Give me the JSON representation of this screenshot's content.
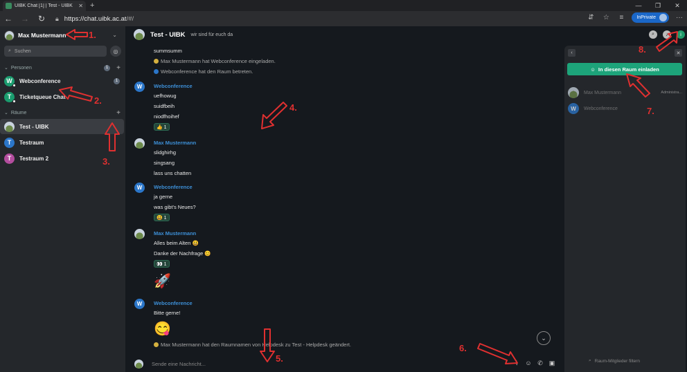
{
  "browser": {
    "tab_title": "UIBK Chat [1] | Test - UIBK",
    "tab_close": "✕",
    "new_tab": "+",
    "url_host": "https://chat.uibk.ac.at",
    "url_path": "/#/",
    "inprivate_label": "InPrivate",
    "win_minimize": "—",
    "win_restore": "❐",
    "win_close": "✕",
    "menu": "···"
  },
  "sidebar": {
    "user_name": "Max Mustermann",
    "search_placeholder": "Suchen",
    "people_header": "Personen",
    "people_count": "1",
    "people": [
      {
        "label": "Webconference",
        "initial": "W",
        "color": "#1a9c6e",
        "badge": "1"
      },
      {
        "label": "Ticketqueue Chat",
        "initial": "T",
        "color": "#1a9c6e"
      }
    ],
    "rooms_header": "Räume",
    "rooms": [
      {
        "label": "Test - UIBK"
      },
      {
        "label": "Testraum",
        "initial": "T",
        "color": "#2b76c9"
      },
      {
        "label": "Testraum 2",
        "initial": "T",
        "color": "#b34d9e"
      }
    ]
  },
  "room": {
    "name": "Test - UIBK",
    "topic": "wir sind für euch da"
  },
  "timeline": {
    "l_summ": "summsumm",
    "st_invite": "Max Mustermann hat Webconference eingeladen.",
    "st_joined": "Webconference hat den Raum betreten.",
    "w1_sender": "Webconference",
    "w1_m1": "uefhowug",
    "w1_m2": "suidfbeih",
    "w1_m3": "niodfhoihef",
    "w1_react": "👍 1",
    "m1_sender": "Max Mustermann",
    "m1_m1": "slidghirhg",
    "m1_m2": "singsang",
    "m1_m3": "lass uns chatten",
    "w2_sender": "Webconference",
    "w2_m1": "ja gerne",
    "w2_m2": "was gibt's Neues?",
    "w2_react": "😃 1",
    "m2_sender": "Max Mustermann",
    "m2_m1": "Alles beim Alten 😃",
    "m2_m2": "Danke der Nachfrage 😊",
    "m2_react": "👀 1",
    "m2_big": "🚀",
    "w3_sender": "Webconference",
    "w3_m1": "Bitte gerne!",
    "w3_big": "😋",
    "st_rename": "Max Mustermann hat den Raumnamen von Helpdesk zu Test - Helpdesk geändert.",
    "avatar_w": "W"
  },
  "composer": {
    "placeholder": "Sende eine Nachricht..."
  },
  "right_panel": {
    "invite_label": "In diesen Raum einladen",
    "members": [
      {
        "name": "Max Mustermann",
        "role": "Administra..."
      },
      {
        "name": "Webconference",
        "initial": "W"
      }
    ],
    "filter_placeholder": "Raum-Mitglieder filtern"
  },
  "annotations": [
    "1.",
    "2.",
    "3.",
    "4.",
    "5.",
    "6.",
    "7.",
    "8."
  ],
  "colors": {
    "accent": "#1da47a",
    "sender": "#3d8fd6",
    "annotation": "#e03030"
  }
}
